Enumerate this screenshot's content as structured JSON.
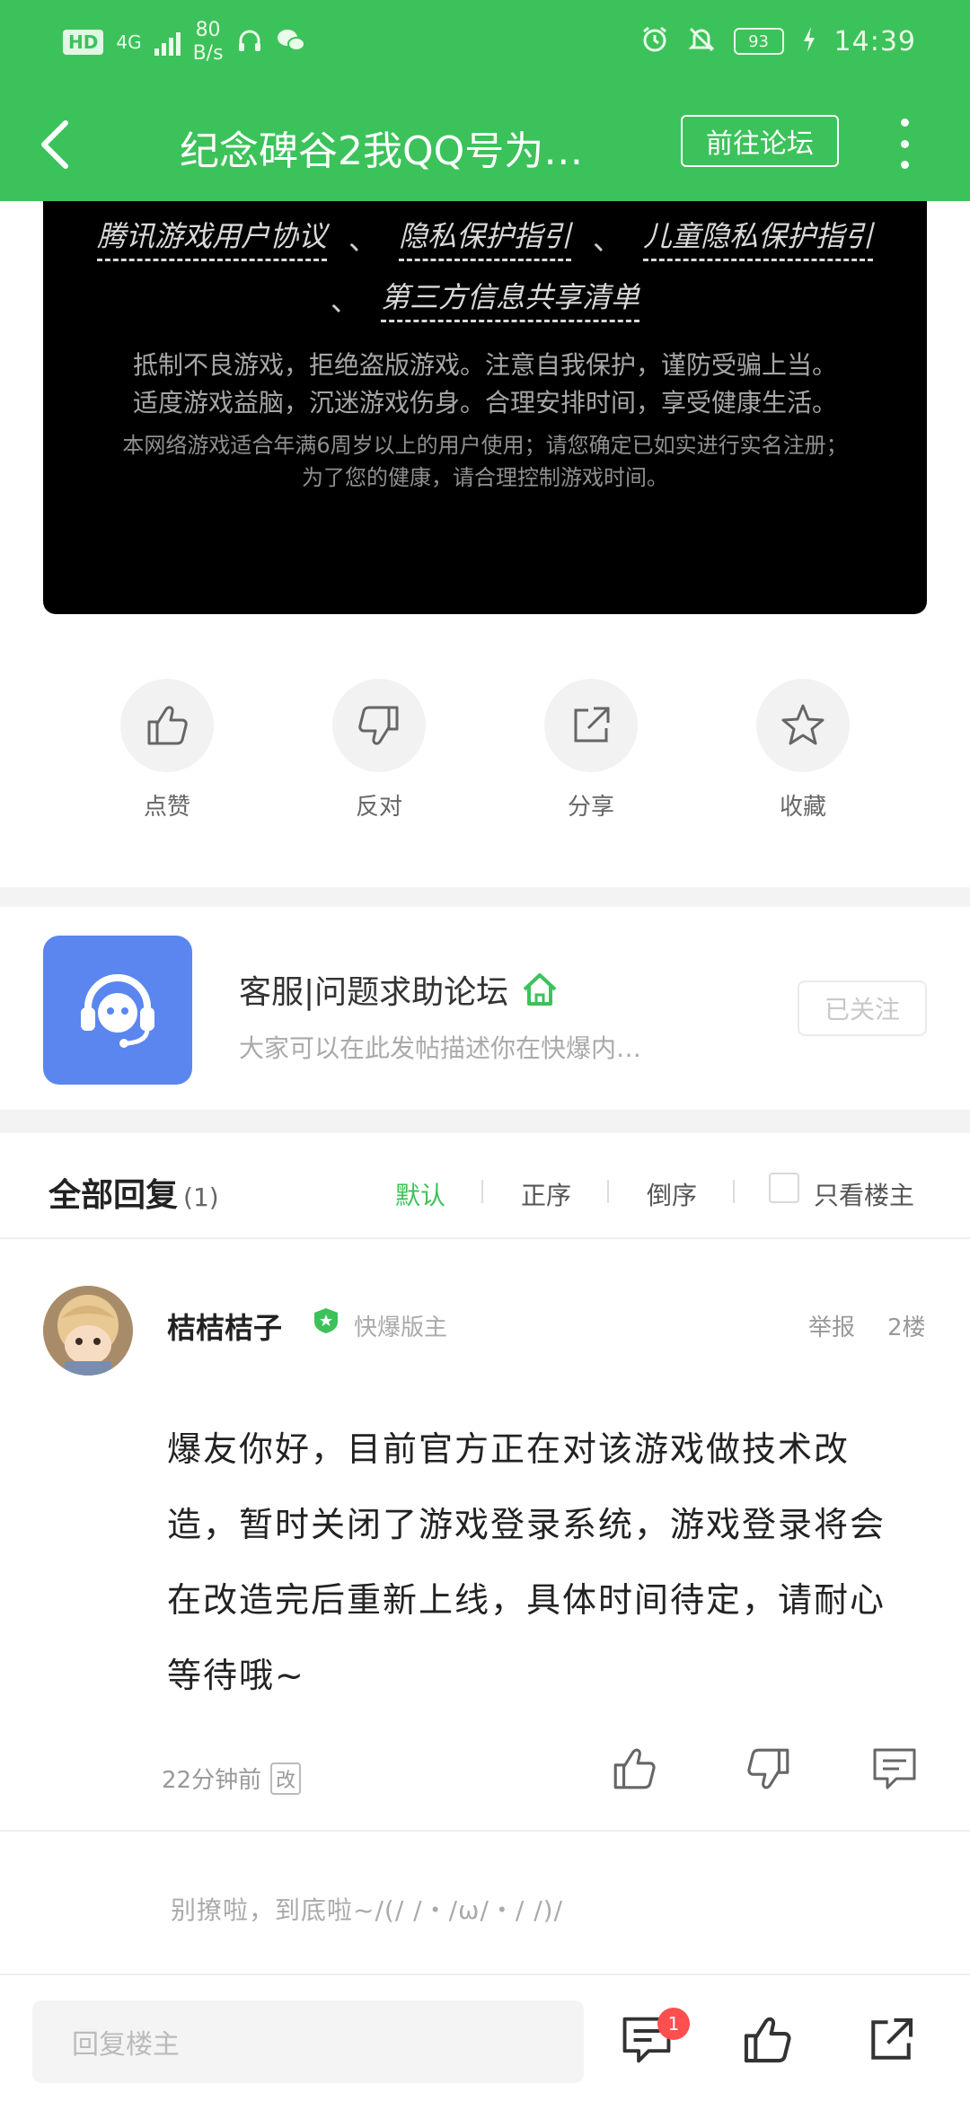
{
  "status_bar": {
    "hd": "HD",
    "network": "4G",
    "speed_value": "80",
    "speed_unit": "B/s",
    "battery": "93",
    "time": "14:39"
  },
  "app_bar": {
    "title": "纪念碑谷2我QQ号为…",
    "forum_button": "前往论坛",
    "back_icon": "back-arrow-icon",
    "more_icon": "more-vertical-icon"
  },
  "notice": {
    "links": [
      "腾讯游戏用户协议",
      "隐私保护指引",
      "儿童隐私保护指引",
      "第三方信息共享清单"
    ],
    "separator": "、",
    "line1": "抵制不良游戏，拒绝盗版游戏。注意自我保护，谨防受骗上当。",
    "line2": "适度游戏益脑，沉迷游戏伤身。合理安排时间，享受健康生活。",
    "line3": "本网络游戏适合年满6周岁以上的用户使用；请您确定已如实进行实名注册；",
    "line4": "为了您的健康，请合理控制游戏时间。"
  },
  "actions": {
    "like": "点赞",
    "dislike": "反对",
    "share": "分享",
    "favorite": "收藏"
  },
  "forum": {
    "name": "客服|问题求助论坛",
    "description": "大家可以在此发帖描述你在快爆内…",
    "follow": "已关注"
  },
  "replies": {
    "title": "全部回复",
    "count": "(1)",
    "sort_default": "默认",
    "sort_asc": "正序",
    "sort_desc": "倒序",
    "only_op": "只看楼主"
  },
  "reply": {
    "user": "桔桔桔子",
    "role": "快爆版主",
    "report": "举报",
    "floor": "2楼",
    "body": "爆友你好，目前官方正在对该游戏做技术改造，暂时关闭了游戏登录系统，游戏登录将会在改造完后重新上线，具体时间待定，请耐心等待哦~",
    "time": "22分钟前",
    "edited": "改"
  },
  "end_text": "别撩啦，到底啦~/(/ /・/ω/・/ /)/",
  "bottom_bar": {
    "input_placeholder": "回复楼主",
    "comment_badge": "1"
  },
  "colors": {
    "brand_green": "#3cc25a",
    "forum_blue": "#5b86ef",
    "badge_red": "#ff4e4e"
  }
}
